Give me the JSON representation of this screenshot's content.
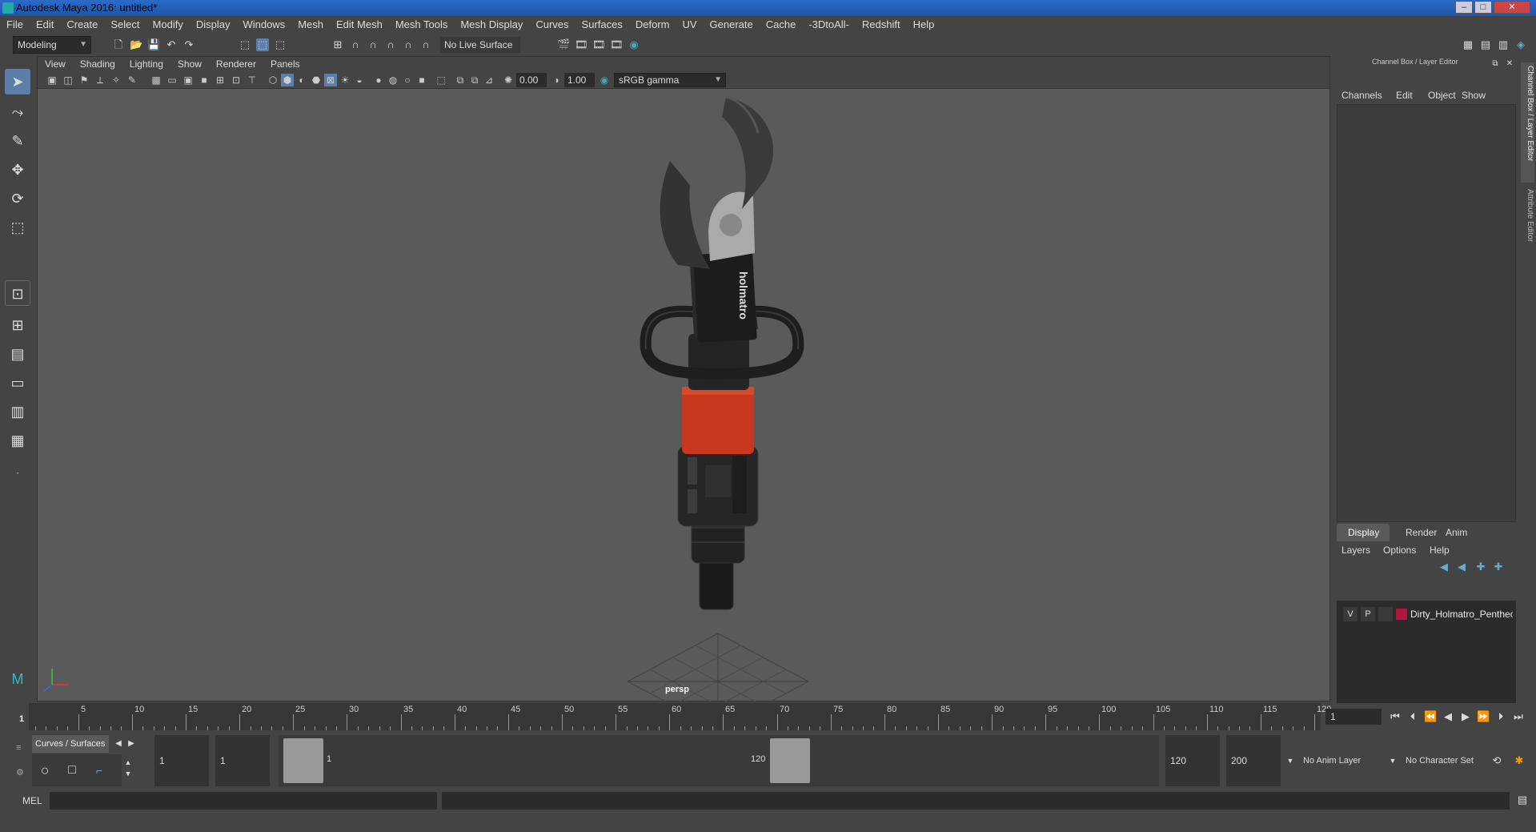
{
  "window": {
    "title": "Autodesk Maya 2016: untitled*",
    "minimize": "–",
    "maximize": "□",
    "close": "✕"
  },
  "menus": [
    "File",
    "Edit",
    "Create",
    "Select",
    "Modify",
    "Display",
    "Windows",
    "Mesh",
    "Edit Mesh",
    "Mesh Tools",
    "Mesh Display",
    "Curves",
    "Surfaces",
    "Deform",
    "UV",
    "Generate",
    "Cache",
    "-3DtoAll-",
    "Redshift",
    "Help"
  ],
  "shelf": {
    "mode": "Modeling",
    "live_surface": "No Live Surface"
  },
  "viewport": {
    "menus": [
      "View",
      "Shading",
      "Lighting",
      "Show",
      "Renderer",
      "Panels"
    ],
    "exposure": "0.00",
    "gamma": "1.00",
    "color_space": "sRGB gamma",
    "camera": "persp",
    "model_brand_text": "holmatro"
  },
  "right_panel": {
    "header": "Channel Box / Layer Editor",
    "vertical_tabs": [
      "Channel Box / Layer Editor",
      "Attribute Editor"
    ],
    "channel_menus": [
      "Channels",
      "Edit",
      "Object",
      "Show"
    ],
    "layer_tabs": [
      "Display",
      "Render",
      "Anim"
    ],
    "layer_menus": [
      "Layers",
      "Options",
      "Help"
    ],
    "layer": {
      "visible": "V",
      "playback": "P",
      "name": "Dirty_Holmatro_Pentheo",
      "color": "#b0173a"
    }
  },
  "timeline": {
    "ticks": [
      5,
      10,
      15,
      20,
      25,
      30,
      35,
      40,
      45,
      50,
      55,
      60,
      65,
      70,
      75,
      80,
      85,
      90,
      95,
      100,
      105,
      110,
      115,
      120
    ],
    "start_marker": "1",
    "current_frame": "1"
  },
  "range": {
    "shelf_tab": "Curves / Surfaces",
    "start": "1",
    "playback_start": "1",
    "range_start_label": "1",
    "range_end_label": "120",
    "playback_end": "120",
    "end": "200",
    "anim_layer": "No Anim Layer",
    "char_set": "No Character Set"
  },
  "command": {
    "label": "MEL"
  }
}
